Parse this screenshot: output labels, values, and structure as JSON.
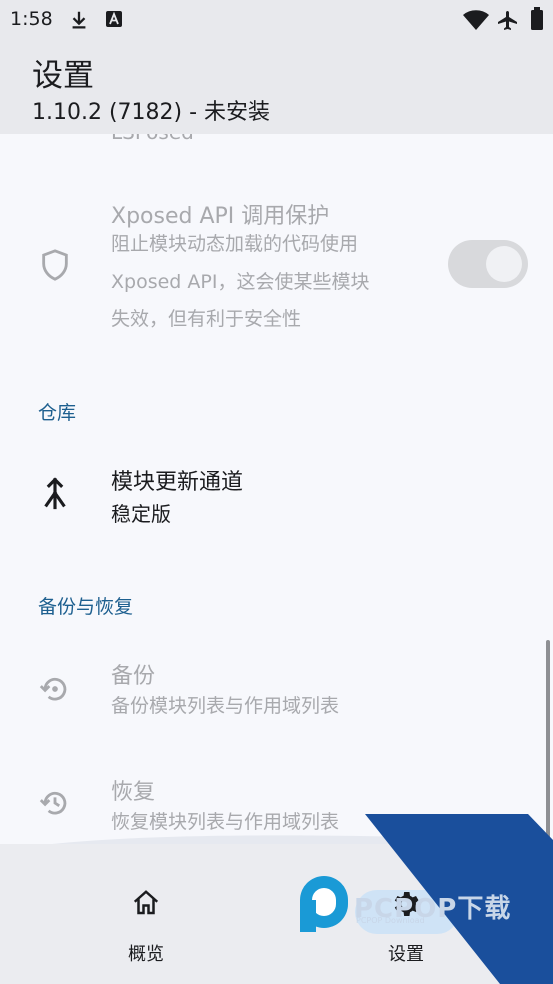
{
  "status_bar": {
    "time": "1:58",
    "icons": [
      "download-icon",
      "a-notification-icon",
      "wifi-icon",
      "airplane-mode-icon",
      "battery-icon"
    ]
  },
  "app_bar": {
    "title": "设置",
    "subtitle": "1.10.2 (7182) - 未安装"
  },
  "content": {
    "clipped_text": "LSPosed",
    "xposed_api_protection": {
      "title": "Xposed API 调用保护",
      "summary_lines": [
        "阻止模块动态加载的代码使用",
        "Xposed API，这会使某些模块",
        "失效，但有利于安全性"
      ],
      "icon": "shield-icon",
      "switch_on": true,
      "enabled": false
    },
    "repository_section": {
      "header": "仓库",
      "update_channel": {
        "title": "模块更新通道",
        "summary": "稳定版",
        "icon": "merge-icon"
      }
    },
    "backup_section": {
      "header": "备份与恢复",
      "backup": {
        "title": "备份",
        "summary": "备份模块列表与作用域列表",
        "icon": "backup-restore-icon",
        "enabled": false
      },
      "restore": {
        "title": "恢复",
        "summary": "恢复模块列表与作用域列表",
        "icon": "history-icon",
        "enabled": false
      }
    }
  },
  "bottom_nav": {
    "items": [
      {
        "label": "概览",
        "icon": "home-icon",
        "selected": false
      },
      {
        "label": "设置",
        "icon": "gear-icon",
        "selected": true
      }
    ]
  },
  "watermark": {
    "text": "PCPOP下载",
    "subtext": "PCPOP Download",
    "logo_color": "#1a4f9c"
  },
  "colors": {
    "accent": "#1d5f8f",
    "disabled_text": "#a8a9ad",
    "app_bar_bg": "#e8e9ed",
    "selected_pill": "#cfe3f6"
  }
}
